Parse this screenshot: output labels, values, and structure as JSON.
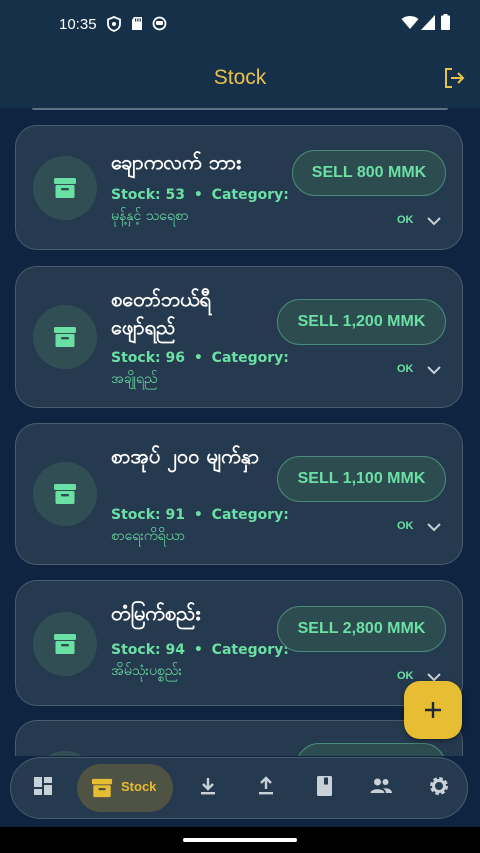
{
  "status_bar": {
    "time": "10:35",
    "icons": [
      "shield-icon",
      "sd-card-icon",
      "notification-icon",
      "wifi-icon",
      "signal-icon",
      "battery-icon"
    ]
  },
  "app_bar": {
    "title": "Stock",
    "logout_icon": "logout-icon"
  },
  "products": [
    {
      "name": "ချောကလက် ဘား",
      "stock_label": "Stock: 53",
      "category_label": "Category:",
      "category": "မုန့်နှင့် သရေစာ",
      "sell_label": "SELL 800 MMK",
      "status": "OK"
    },
    {
      "name": "စတော်ဘယ်ရီ ဖျော်ရည်",
      "stock_label": "Stock: 96",
      "category_label": "Category:",
      "category": "အချိုရည်",
      "sell_label": "SELL 1,200 MMK",
      "status": "OK"
    },
    {
      "name": "စာအုပ် ၂၀၀ မျက်နှာ",
      "stock_label": "Stock: 91",
      "category_label": "Category:",
      "category": "စာရေးကိရိယာ",
      "sell_label": "SELL 1,100 MMK",
      "status": "OK"
    },
    {
      "name": "တံမြက်စည်း",
      "stock_label": "Stock: 94",
      "category_label": "Category:",
      "category": "အိမ်သုံးပစ္စည်း",
      "sell_label": "SELL 2,800 MMK",
      "status": "OK"
    }
  ],
  "meta_separator": "•",
  "fab": {
    "icon": "plus-icon"
  },
  "bottom_nav": {
    "items": [
      {
        "icon": "dashboard-icon",
        "label": ""
      },
      {
        "icon": "inventory-icon",
        "label": "Stock",
        "active": true
      },
      {
        "icon": "download-icon",
        "label": ""
      },
      {
        "icon": "upload-icon",
        "label": ""
      },
      {
        "icon": "book-icon",
        "label": ""
      },
      {
        "icon": "people-icon",
        "label": ""
      },
      {
        "icon": "settings-icon",
        "label": ""
      }
    ]
  },
  "colors": {
    "background": "#0f2440",
    "card": "#263a4f",
    "accent_yellow": "#e7be33",
    "accent_green": "#6be0a4"
  }
}
